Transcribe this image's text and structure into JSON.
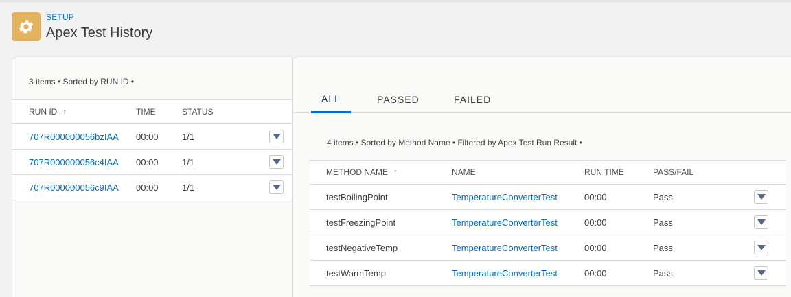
{
  "header": {
    "breadcrumb": "SETUP",
    "title": "Apex Test History",
    "icon": "gear-icon",
    "icon_color": "#e3b35e"
  },
  "left": {
    "list_info": "3 items • Sorted by RUN ID •",
    "columns": {
      "run_id": "RUN ID",
      "time": "TIME",
      "status": "STATUS"
    },
    "sort_arrow": "↑",
    "rows": [
      {
        "run_id": "707R000000056bzIAA",
        "time": "00:00",
        "status": "1/1"
      },
      {
        "run_id": "707R000000056c4IAA",
        "time": "00:00",
        "status": "1/1"
      },
      {
        "run_id": "707R000000056c9IAA",
        "time": "00:00",
        "status": "1/1"
      }
    ]
  },
  "right": {
    "tabs": [
      {
        "label": "ALL",
        "active": true
      },
      {
        "label": "PASSED",
        "active": false
      },
      {
        "label": "FAILED",
        "active": false
      }
    ],
    "list_info": "4 items • Sorted by Method Name • Filtered by Apex Test Run Result •",
    "columns": {
      "method": "METHOD NAME",
      "name": "NAME",
      "run_time": "RUN TIME",
      "pass_fail": "PASS/FAIL"
    },
    "sort_arrow": "↑",
    "rows": [
      {
        "method": "testBoilingPoint",
        "name": "TemperatureConverterTest",
        "run_time": "00:00",
        "result": "Pass"
      },
      {
        "method": "testFreezingPoint",
        "name": "TemperatureConverterTest",
        "run_time": "00:00",
        "result": "Pass"
      },
      {
        "method": "testNegativeTemp",
        "name": "TemperatureConverterTest",
        "run_time": "00:00",
        "result": "Pass"
      },
      {
        "method": "testWarmTemp",
        "name": "TemperatureConverterTest",
        "run_time": "00:00",
        "result": "Pass"
      }
    ]
  },
  "colors": {
    "link": "#006dcc",
    "accent": "#0070d2"
  }
}
